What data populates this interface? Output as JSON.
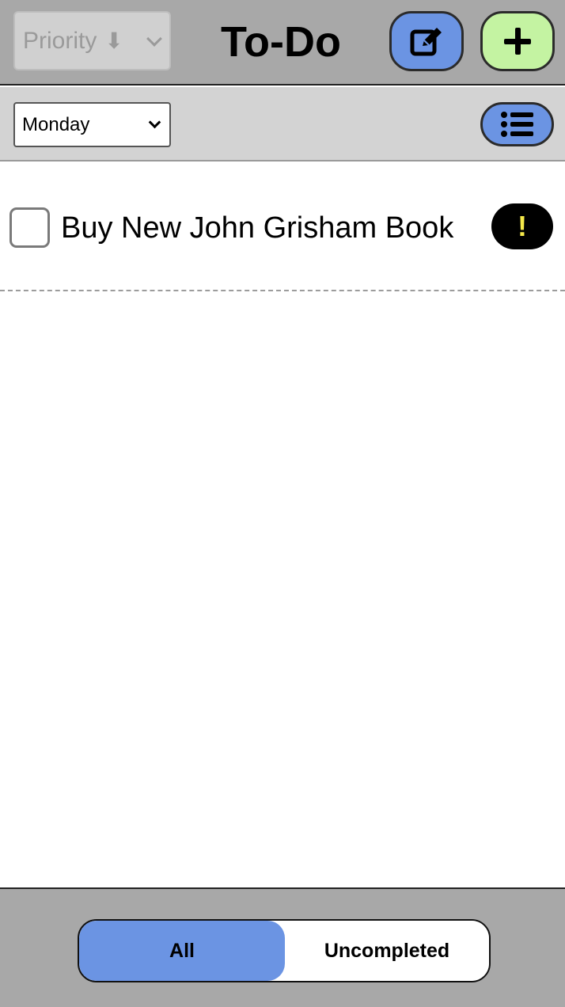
{
  "header": {
    "title": "To-Do",
    "sort": {
      "selected": "Priority",
      "arrow_icon": "arrow-down-icon"
    },
    "edit_button_icon": "edit-icon",
    "add_button_icon": "plus-icon"
  },
  "filter": {
    "day_selected": "Monday",
    "list_button_icon": "list-icon"
  },
  "tasks": [
    {
      "label": "Buy New John Grisham Book",
      "completed": false,
      "priority_mark": "!"
    }
  ],
  "footer": {
    "segments": [
      {
        "label": "All",
        "active": true
      },
      {
        "label": "Uncompleted",
        "active": false
      }
    ]
  },
  "colors": {
    "header_bg": "#a8a8a8",
    "subbar_bg": "#d3d3d3",
    "accent_blue": "#6b94e3",
    "add_green": "#c4f3a2",
    "priority_yellow": "#f5e94a"
  }
}
